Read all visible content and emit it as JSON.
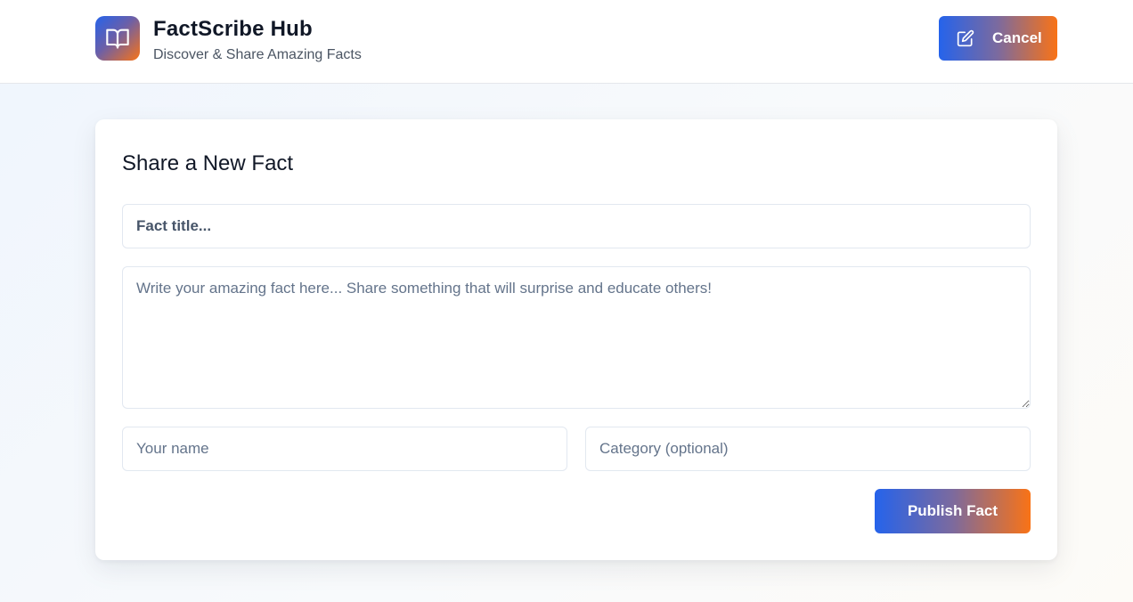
{
  "header": {
    "app_name": "FactScribe Hub",
    "tagline": "Discover & Share Amazing Facts",
    "logo_icon": "open-book-icon",
    "cancel_label": "Cancel",
    "cancel_icon": "edit-icon"
  },
  "form": {
    "heading": "Share a New Fact",
    "title_placeholder": "Fact title...",
    "body_placeholder": "Write your amazing fact here... Share something that will surprise and educate others!",
    "name_placeholder": "Your name",
    "category_placeholder": "Category (optional)",
    "submit_label": "Publish Fact"
  },
  "colors": {
    "gradient_start": "#2563eb",
    "gradient_end": "#f97316",
    "text_primary": "#111827",
    "text_muted": "#4b5563",
    "border": "#e2e8f0"
  }
}
